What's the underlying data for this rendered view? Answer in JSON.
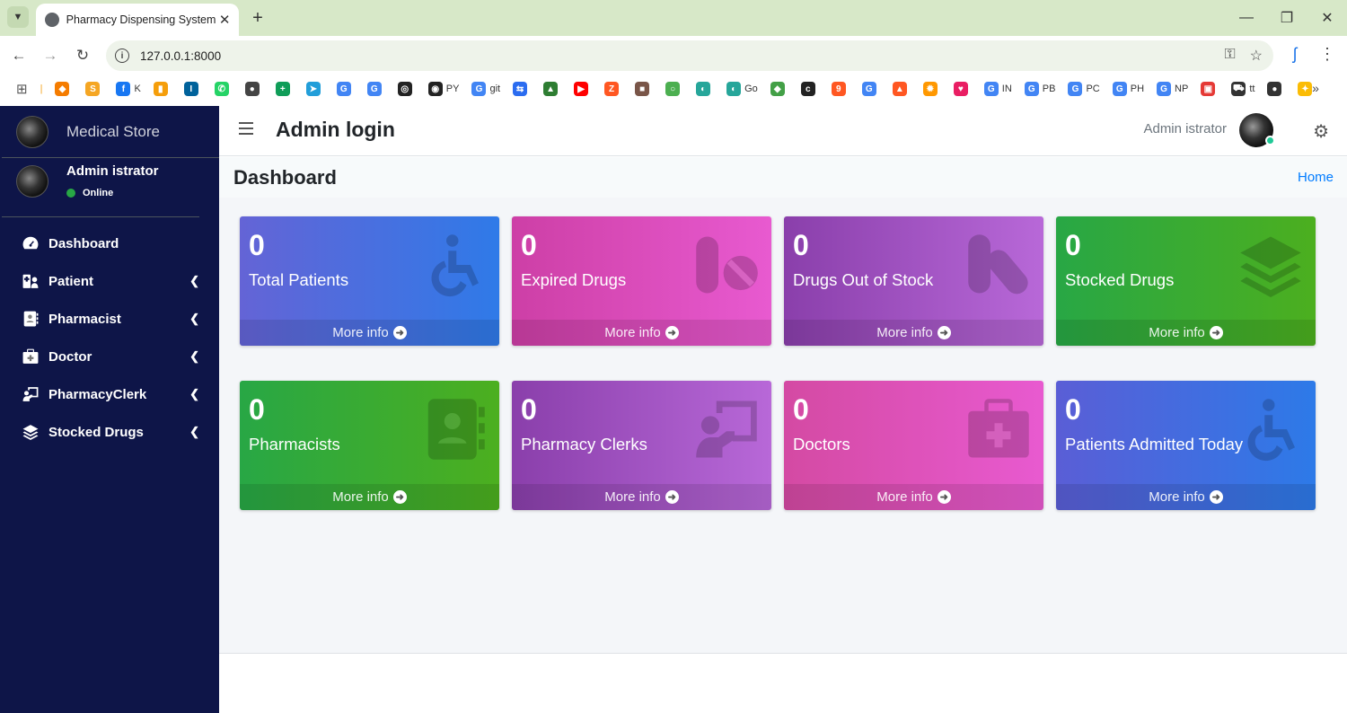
{
  "browser": {
    "tab_title": "Pharmacy Dispensing System",
    "url": "127.0.0.1:8000",
    "bookmarks": [
      {
        "label": "",
        "color": "#f57c00",
        "glyph": "◆"
      },
      {
        "label": "",
        "color": "#f5a623",
        "glyph": "S"
      },
      {
        "label": "K",
        "color": "#1877f2",
        "glyph": "f"
      },
      {
        "label": "",
        "color": "#f59e0b",
        "glyph": "▮"
      },
      {
        "label": "",
        "color": "#00629b",
        "glyph": "I"
      },
      {
        "label": "",
        "color": "#25d366",
        "glyph": "✆"
      },
      {
        "label": "",
        "color": "#444444",
        "glyph": "●"
      },
      {
        "label": "",
        "color": "#0f9d58",
        "glyph": "+"
      },
      {
        "label": "",
        "color": "#229ed9",
        "glyph": "➤"
      },
      {
        "label": "",
        "color": "#4285f4",
        "glyph": "G"
      },
      {
        "label": "",
        "color": "#4285f4",
        "glyph": "G"
      },
      {
        "label": "",
        "color": "#222222",
        "glyph": "◎"
      },
      {
        "label": "PY",
        "color": "#222222",
        "glyph": "◉"
      },
      {
        "label": "git",
        "color": "#4285f4",
        "glyph": "G"
      },
      {
        "label": "",
        "color": "#2b6cf0",
        "glyph": "⇆"
      },
      {
        "label": "",
        "color": "#2e7d32",
        "glyph": "▲"
      },
      {
        "label": "",
        "color": "#ff0000",
        "glyph": "▶"
      },
      {
        "label": "",
        "color": "#ff5722",
        "glyph": "Z"
      },
      {
        "label": "",
        "color": "#795548",
        "glyph": "■"
      },
      {
        "label": "",
        "color": "#4caf50",
        "glyph": "○"
      },
      {
        "label": "",
        "color": "#26a69a",
        "glyph": "◐"
      },
      {
        "label": "Go",
        "color": "#26a69a",
        "glyph": "◐"
      },
      {
        "label": "",
        "color": "#43a047",
        "glyph": "◆"
      },
      {
        "label": "",
        "color": "#222222",
        "glyph": "c"
      },
      {
        "label": "",
        "color": "#ff5722",
        "glyph": "9"
      },
      {
        "label": "",
        "color": "#4285f4",
        "glyph": "G"
      },
      {
        "label": "",
        "color": "#ff5722",
        "glyph": "▲"
      },
      {
        "label": "",
        "color": "#ff9800",
        "glyph": "✹"
      },
      {
        "label": "",
        "color": "#e91e63",
        "glyph": "♥"
      },
      {
        "label": "IN",
        "color": "#4285f4",
        "glyph": "G"
      },
      {
        "label": "PB",
        "color": "#4285f4",
        "glyph": "G"
      },
      {
        "label": "PC",
        "color": "#4285f4",
        "glyph": "G"
      },
      {
        "label": "PH",
        "color": "#4285f4",
        "glyph": "G"
      },
      {
        "label": "NP",
        "color": "#4285f4",
        "glyph": "G"
      },
      {
        "label": "",
        "color": "#e53935",
        "glyph": "▣"
      },
      {
        "label": "tt",
        "color": "#333333",
        "glyph": "⛟"
      },
      {
        "label": "",
        "color": "#333333",
        "glyph": "●"
      },
      {
        "label": "",
        "color": "#fbbc05",
        "glyph": "✦"
      }
    ]
  },
  "sidebar": {
    "brand": "Medical Store",
    "user_name": "Admin istrator",
    "status": "Online",
    "items": [
      {
        "label": "Dashboard",
        "icon": "tachometer-icon",
        "has_children": false
      },
      {
        "label": "Patient",
        "icon": "hospital-user-icon",
        "has_children": true
      },
      {
        "label": "Pharmacist",
        "icon": "address-book-icon",
        "has_children": true
      },
      {
        "label": "Doctor",
        "icon": "medkit-icon",
        "has_children": true
      },
      {
        "label": "PharmacyClerk",
        "icon": "chalkboard-teacher-icon",
        "has_children": true
      },
      {
        "label": "Stocked Drugs",
        "icon": "layers-icon",
        "has_children": true
      }
    ]
  },
  "header": {
    "title": "Admin login",
    "user_name": "Admin istrator"
  },
  "content": {
    "page_title": "Dashboard",
    "breadcrumb_home": "Home",
    "cards": [
      {
        "count": "0",
        "label": "Total Patients",
        "footer": "More info",
        "theme": "g-blue",
        "icon": "wheelchair-icon"
      },
      {
        "count": "0",
        "label": "Expired Drugs",
        "footer": "More info",
        "theme": "g-pink",
        "icon": "pills-icon"
      },
      {
        "count": "0",
        "label": "Drugs Out of Stock",
        "footer": "More info",
        "theme": "g-purple",
        "icon": "capsules-icon"
      },
      {
        "count": "0",
        "label": "Stocked Drugs",
        "footer": "More info",
        "theme": "g-green",
        "icon": "layers-icon"
      },
      {
        "count": "0",
        "label": "Pharmacists",
        "footer": "More info",
        "theme": "g-green",
        "icon": "address-book-icon"
      },
      {
        "count": "0",
        "label": "Pharmacy Clerks",
        "footer": "More info",
        "theme": "g-purple",
        "icon": "chalkboard-teacher-icon"
      },
      {
        "count": "0",
        "label": "Doctors",
        "footer": "More info",
        "theme": "g-pink2",
        "icon": "medkit-icon"
      },
      {
        "count": "0",
        "label": "Patients Admitted Today",
        "footer": "More info",
        "theme": "g-blue2",
        "icon": "wheelchair-icon"
      }
    ]
  }
}
